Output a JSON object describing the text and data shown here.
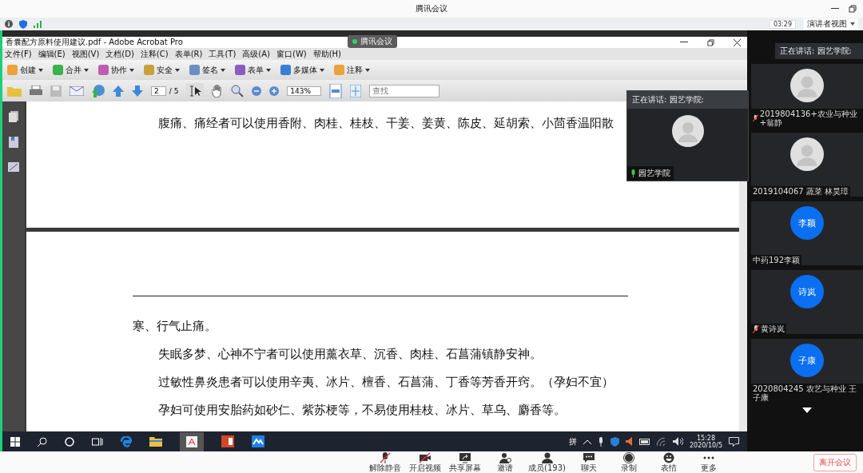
{
  "window": {
    "title": "腾讯会议"
  },
  "info_bar": {
    "timer": "03:29",
    "view_mode": "演讲者视图"
  },
  "shared_screen": {
    "floating_tag": "腾讯会议",
    "acrobat": {
      "title": "香囊配方原料使用建议.pdf - Adobe Acrobat Pro",
      "menu": [
        "文件(F)",
        "编辑(E)",
        "视图(V)",
        "文档(D)",
        "注释(C)",
        "表单(R)",
        "工具(T)",
        "高级(A)",
        "窗口(W)",
        "帮助(H)"
      ],
      "tools": [
        "创建",
        "合并",
        "协作",
        "安全",
        "签名",
        "表单",
        "多媒体",
        "注释"
      ],
      "page_number": "2",
      "page_total": "/ 5",
      "zoom": "143%",
      "search_placeholder": "查找",
      "page_top_lines": [
        "腹痛、痛经者可以使用香附、肉桂、桂枝、干姜、姜黄、陈皮、延胡索、小茴香温阳散"
      ],
      "page_lines": [
        {
          "kind": "continuation",
          "text": "寒、行气止痛。"
        },
        {
          "kind": "paragraph",
          "text": "失眠多梦、心神不宁者可以使用薰衣草、沉香、肉桂、石菖蒲镇静安神。"
        },
        {
          "kind": "paragraph",
          "text": "过敏性鼻炎患者可以使用辛夷、冰片、檀香、石菖蒲、丁香等芳香开窍。（孕妇不宜）"
        },
        {
          "kind": "paragraph",
          "text": "孕妇可使用安胎药如砂仁、紫苏梗等，不易使用桂枝、冰片、草乌、麝香等。"
        }
      ]
    },
    "taskbar": {
      "ime": "拼",
      "time": "15:28",
      "date": "2020/10/5"
    }
  },
  "speaker_popup": {
    "header": "正在讲话: 园艺学院:",
    "name": "园艺学院"
  },
  "participants": {
    "header": "正在讲话: 园艺学院:",
    "tiles": [
      {
        "kind": "photo",
        "name": "2019804136+农业与种业+翁静",
        "muted": true
      },
      {
        "kind": "photo",
        "name": "2019104067 蔬菜 林昊璋",
        "muted": false
      },
      {
        "kind": "initials",
        "initials": "李颖",
        "name": "中药192李颖",
        "muted": false
      },
      {
        "kind": "initials",
        "initials": "诗岚",
        "name": "黄诗岚",
        "muted": true
      },
      {
        "kind": "initials",
        "initials": "子康",
        "name": "2020804245 农艺与种业 王子康",
        "muted": false
      }
    ]
  },
  "toolbar": {
    "items": [
      {
        "kind": "mic-off",
        "label": "解除静音"
      },
      {
        "kind": "video-off",
        "label": "开启视频"
      },
      {
        "kind": "share",
        "label": "共享屏幕"
      },
      {
        "kind": "invite",
        "label": "邀请"
      },
      {
        "kind": "members",
        "label": "成员(193)"
      },
      {
        "kind": "chat",
        "label": "聊天"
      },
      {
        "kind": "record",
        "label": "录制"
      },
      {
        "kind": "emoji",
        "label": "表情"
      },
      {
        "kind": "more",
        "label": "更多"
      }
    ],
    "leave": "离开会议"
  }
}
